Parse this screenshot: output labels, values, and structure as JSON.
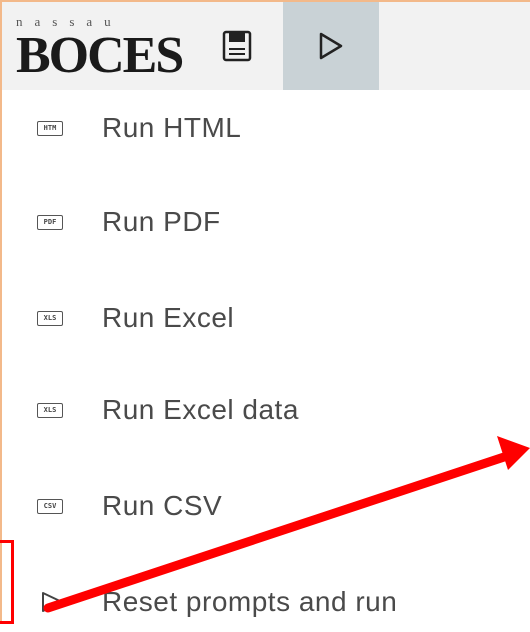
{
  "logo": {
    "small": "nassau",
    "big": "BOCES"
  },
  "toolbar": {
    "save_icon": "save-icon",
    "run_icon": "play-icon"
  },
  "menu": {
    "items": [
      {
        "icon_text": "HTM",
        "label": "Run HTML"
      },
      {
        "icon_text": "PDF",
        "label": "Run PDF"
      },
      {
        "icon_text": "XLS",
        "label": "Run Excel"
      },
      {
        "icon_text": "XLS",
        "label": "Run Excel data"
      },
      {
        "icon_text": "CSV",
        "label": "Run CSV"
      },
      {
        "icon_text": "",
        "label": "Reset prompts and run"
      }
    ]
  },
  "annotation": {
    "arrow_color": "#ff0000"
  }
}
